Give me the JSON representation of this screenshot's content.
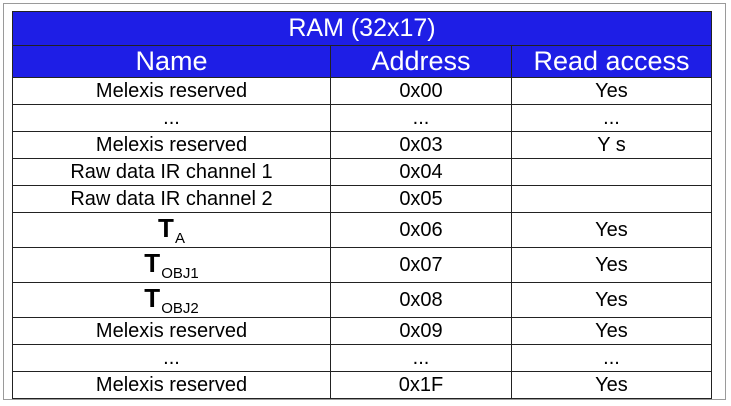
{
  "table": {
    "title": "RAM (32x17)",
    "headers": [
      "Name",
      "Address",
      "Read access"
    ],
    "rows": [
      {
        "name": "Melexis reserved",
        "address": "0x00",
        "read": "Yes"
      },
      {
        "name": "...",
        "address": "...",
        "read": "..."
      },
      {
        "name": "Melexis reserved",
        "address": "0x03",
        "read": "Y s"
      },
      {
        "name": "Raw data IR channel 1",
        "address": "0x04",
        "read": ""
      },
      {
        "name": "Raw data IR channel 2",
        "address": "0x05",
        "read": ""
      },
      {
        "name_main": "T",
        "name_sub": "A",
        "address": "0x06",
        "read": "Yes"
      },
      {
        "name_main": "T",
        "name_sub": "OBJ1",
        "address": "0x07",
        "read": "Yes"
      },
      {
        "name_main": "T",
        "name_sub": "OBJ2",
        "address": "0x08",
        "read": "Yes"
      },
      {
        "name": "Melexis reserved",
        "address": "0x09",
        "read": "Yes"
      },
      {
        "name": "...",
        "address": "...",
        "read": "..."
      },
      {
        "name": "Melexis reserved",
        "address": "0x1F",
        "read": "Yes"
      }
    ]
  }
}
